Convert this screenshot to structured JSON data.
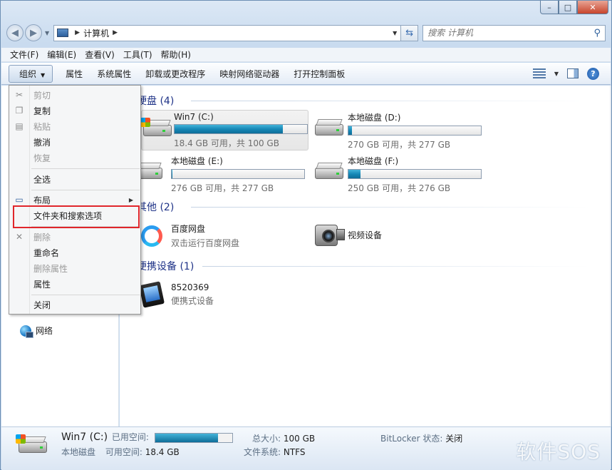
{
  "window": {
    "caption_min": "–",
    "caption_max": "□",
    "caption_close": "✕"
  },
  "address": {
    "crumb": "计算机",
    "search_placeholder": "搜索 计算机"
  },
  "menubar": {
    "file": "文件(F)",
    "edit": "编辑(E)",
    "view": "查看(V)",
    "tools": "工具(T)",
    "help": "帮助(H)"
  },
  "cmdbar": {
    "organize": "组织",
    "properties": "属性",
    "system_properties": "系统属性",
    "uninstall": "卸载或更改程序",
    "map_drive": "映射网络驱动器",
    "control_panel": "打开控制面板"
  },
  "dropdown": {
    "items": [
      {
        "label": "剪切",
        "disabled": true
      },
      {
        "label": "复制",
        "disabled": false
      },
      {
        "label": "粘贴",
        "disabled": true
      },
      {
        "label": "撤消",
        "disabled": false
      },
      {
        "label": "恢复",
        "disabled": true
      },
      {
        "label": "全选",
        "disabled": false
      },
      {
        "label": "布局",
        "disabled": false
      },
      {
        "label": "文件夹和搜索选项",
        "disabled": false
      },
      {
        "label": "删除",
        "disabled": true
      },
      {
        "label": "重命名",
        "disabled": false
      },
      {
        "label": "删除属性",
        "disabled": true
      },
      {
        "label": "属性",
        "disabled": false
      },
      {
        "label": "关闭",
        "disabled": false
      }
    ]
  },
  "navpane": {
    "network": "网络"
  },
  "groups": {
    "hdd": "硬盘 (4)",
    "other": "其他 (2)",
    "portable": "便携设备 (1)"
  },
  "drives": [
    {
      "name": "Win7 (C:)",
      "free": "18.4 GB 可用，共 100 GB",
      "used_fraction": 0.816
    },
    {
      "name": "本地磁盘 (D:)",
      "free": "270 GB 可用，共 277 GB",
      "used_fraction": 0.025
    },
    {
      "name": "本地磁盘 (E:)",
      "free": "276 GB 可用，共 277 GB",
      "used_fraction": 0.004
    },
    {
      "name": "本地磁盘 (F:)",
      "free": "250 GB 可用，共 276 GB",
      "used_fraction": 0.094
    }
  ],
  "other_items": [
    {
      "name": "百度网盘",
      "sub": "双击运行百度网盘"
    },
    {
      "name": "视频设备",
      "sub": ""
    }
  ],
  "portable_items": [
    {
      "name": "8520369",
      "sub": "便携式设备"
    }
  ],
  "details": {
    "name": "Win7 (C:)",
    "type": "本地磁盘",
    "used_label": "已用空间:",
    "free_label": "可用空间:",
    "free_value": "18.4 GB",
    "total_label": "总大小:",
    "total_value": "100 GB",
    "fs_label": "文件系统:",
    "fs_value": "NTFS",
    "bitlocker_label": "BitLocker 状态:",
    "bitlocker_value": "关闭",
    "used_fraction": 0.816
  },
  "watermark": "软件SOS"
}
